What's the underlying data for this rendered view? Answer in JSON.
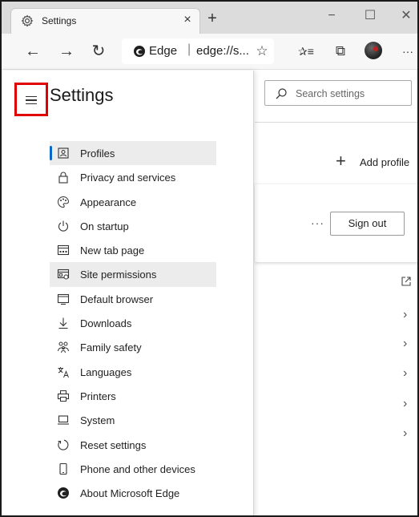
{
  "window": {
    "tab_title": "Settings",
    "tab_close": "×",
    "new_tab": "+",
    "minimize": "−",
    "maximize": "☐",
    "close": "✕"
  },
  "toolbar": {
    "back": "←",
    "forward": "→",
    "refresh": "↻",
    "omnibox_brand": "Edge",
    "omnibox_separator": "|",
    "omnibox_url": "edge://s...",
    "favorite": "☆",
    "favorites_list": "✰≡",
    "collections": "⧉",
    "more": "···"
  },
  "sidebar": {
    "title": "Settings",
    "items": [
      {
        "label": "Profiles",
        "icon": "profile-icon"
      },
      {
        "label": "Privacy and services",
        "icon": "lock-icon"
      },
      {
        "label": "Appearance",
        "icon": "palette-icon"
      },
      {
        "label": "On startup",
        "icon": "power-icon"
      },
      {
        "label": "New tab page",
        "icon": "new-tab-page-icon"
      },
      {
        "label": "Site permissions",
        "icon": "site-permissions-icon"
      },
      {
        "label": "Default browser",
        "icon": "default-browser-icon"
      },
      {
        "label": "Downloads",
        "icon": "download-icon"
      },
      {
        "label": "Family safety",
        "icon": "family-icon"
      },
      {
        "label": "Languages",
        "icon": "language-icon"
      },
      {
        "label": "Printers",
        "icon": "printer-icon"
      },
      {
        "label": "System",
        "icon": "system-icon"
      },
      {
        "label": "Reset settings",
        "icon": "reset-icon"
      },
      {
        "label": "Phone and other devices",
        "icon": "phone-icon"
      },
      {
        "label": "About Microsoft Edge",
        "icon": "edge-icon"
      }
    ]
  },
  "main": {
    "search_placeholder": "Search settings",
    "add_profile_label": "Add profile",
    "add_plus": "+",
    "more_dots": "···",
    "sign_out_label": "Sign out",
    "chevron": "›"
  },
  "colors": {
    "highlight": "#e00000",
    "accent": "#0a66c8",
    "selected_bg": "#ececec"
  }
}
